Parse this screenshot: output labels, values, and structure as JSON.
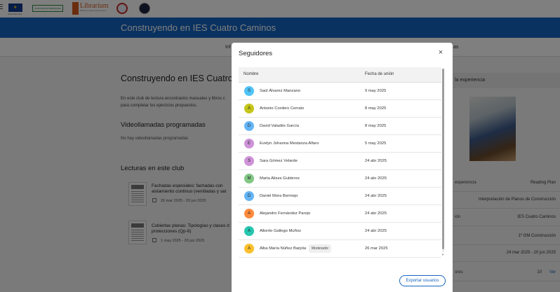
{
  "header": {
    "logos": {
      "eu_caption": "Unión Europea",
      "green_logo": "JUNTA DE EXTREMADURA",
      "librarium_name": "Librarium",
      "librarium_tagline": "Biblioteca digital de Extremadura"
    }
  },
  "banner": {
    "title": "Construyendo en IES Cuatro Caminos"
  },
  "tabs": {
    "partial_label": "Inf",
    "partial_label_right": "as"
  },
  "main": {
    "title": "Construyendo en IES Cuatro C",
    "description_line1": "En este club de lectura encontraréis manuales y libros c",
    "description_line2": "para completar los ejercicios propuestos.",
    "videocalls_heading": "Videollamadas programadas",
    "videocalls_empty": "No hay videollamadas programadas",
    "readings_heading": "Lecturas en este club",
    "books": [
      {
        "title_line1": "Fachadas especiales: fachadas con",
        "title_line2": "aislamiento continuo (ventiladas y sat",
        "dates": "26 mar 2025 - 20 jun 2025"
      },
      {
        "title_line1": "Cubiertas planas: Tipologías y clases d",
        "title_line2": "protecciones (Qp-6)",
        "dates": "1 may 2025 - 20 jun 2025"
      }
    ]
  },
  "right_panel": {
    "header": "la experiencia",
    "rows": [
      {
        "key": "experiencia",
        "value": "Reading Plan"
      },
      {
        "key": "",
        "value": "Interpretación de Planos de Construcción"
      },
      {
        "key": "ión",
        "value": "IES Cuatro Caminos"
      },
      {
        "key": "",
        "value": "1º GM Construcción"
      },
      {
        "key": "",
        "value": "24 mar 2025 - 20 jun 2025"
      },
      {
        "key": "ores",
        "value": "10",
        "link": "Ver"
      }
    ]
  },
  "modal": {
    "title": "Seguidores",
    "close_icon": "close-icon",
    "columns": {
      "name": "Nombre",
      "date": "Fecha de unión"
    },
    "followers": [
      {
        "initial": "S",
        "name": "Saúl Álvarez Manzano",
        "date": "9 may 2025",
        "color": "#4fc3f7"
      },
      {
        "initial": "A",
        "name": "Antonio Cordero Cerrato",
        "date": "8 may 2025",
        "color": "#c5c51a"
      },
      {
        "initial": "D",
        "name": "David Valadés García",
        "date": "8 may 2025",
        "color": "#64b5f6"
      },
      {
        "initial": "E",
        "name": "Evelyn Johanna Mestanza Alfaro",
        "date": "5 may 2025",
        "color": "#ce93d8"
      },
      {
        "initial": "S",
        "name": "Sara Gómez Velarde",
        "date": "24 abr 2025",
        "color": "#ce93d8"
      },
      {
        "initial": "M",
        "name": "Marta Alises Gutiérrez",
        "date": "24 abr 2025",
        "color": "#81c784"
      },
      {
        "initial": "D",
        "name": "Daniel Mora Bermejo",
        "date": "24 abr 2025",
        "color": "#64b5f6"
      },
      {
        "initial": "A",
        "name": "Alejandro Fernández Parejo",
        "date": "24 abr 2025",
        "color": "#ff8a3d"
      },
      {
        "initial": "A",
        "name": "Alberto Gallego Muñoz",
        "date": "24 abr 2025",
        "color": "#26c6b0"
      },
      {
        "initial": "A",
        "name": "Alba María Núñez Barjola",
        "role": "Moderador",
        "date": "26 mar 2025",
        "color": "#fbc02d"
      }
    ],
    "export_button": "Exportar usuarios"
  }
}
